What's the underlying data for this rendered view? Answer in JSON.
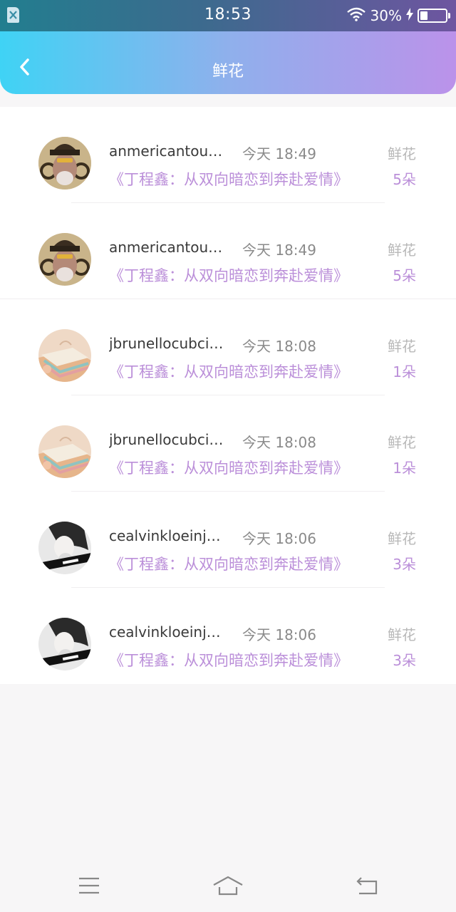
{
  "status_bar": {
    "time": "18:53",
    "battery": "30%",
    "battery_level": 0.3
  },
  "header": {
    "title": "鲜花"
  },
  "rows": [
    {
      "name": "anmericantou…",
      "time": "今天 18:49",
      "gift": "鲜花",
      "article": "《丁程鑫：从双向暗恋到奔赴爱情》",
      "count": "5朵"
    },
    {
      "name": "anmericantou…",
      "time": "今天 18:49",
      "gift": "鲜花",
      "article": "《丁程鑫：从双向暗恋到奔赴爱情》",
      "count": "5朵"
    },
    {
      "name": "jbrunellocubci…",
      "time": "今天 18:08",
      "gift": "鲜花",
      "article": "《丁程鑫：从双向暗恋到奔赴爱情》",
      "count": "1朵"
    },
    {
      "name": "jbrunellocubci…",
      "time": "今天 18:08",
      "gift": "鲜花",
      "article": "《丁程鑫：从双向暗恋到奔赴爱情》",
      "count": "1朵"
    },
    {
      "name": "cealvinkloeinj…",
      "time": "今天 18:06",
      "gift": "鲜花",
      "article": "《丁程鑫：从双向暗恋到奔赴爱情》",
      "count": "3朵"
    },
    {
      "name": "cealvinkloeinj…",
      "time": "今天 18:06",
      "gift": "鲜花",
      "article": "《丁程鑫：从双向暗恋到奔赴爱情》",
      "count": "3朵"
    }
  ],
  "icons": {
    "back": "chevron-left-icon",
    "menu": "menu-icon",
    "home": "home-icon",
    "return": "return-icon"
  },
  "colors": {
    "accent": "#bb8fd9",
    "header_start": "#3fd3f5",
    "header_end": "#bb92ea"
  }
}
